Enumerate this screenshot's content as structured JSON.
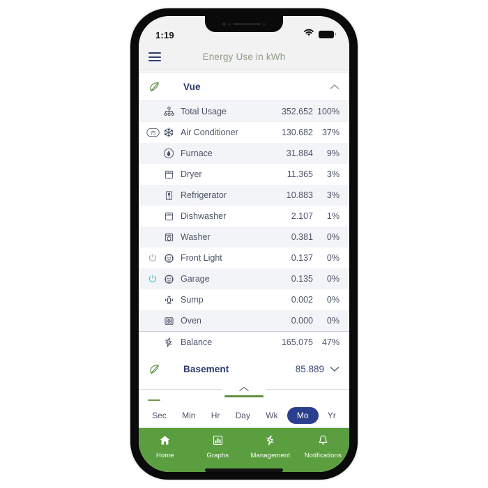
{
  "status_bar": {
    "time": "1:19",
    "wifi_icon": "wifi-icon",
    "battery_icon": "battery-full-icon"
  },
  "app_bar": {
    "menu_icon": "hamburger-menu-icon",
    "title": "Energy Use in kWh",
    "title_color": "#8f9c80"
  },
  "devices": [
    {
      "leaf_icon": "leaf-icon",
      "name": "Vue",
      "value": "",
      "expanded": true,
      "collapse_icon": "chevron-up-icon"
    },
    {
      "leaf_icon": "leaf-icon",
      "name": "Basement",
      "value": "85.889",
      "expanded": false,
      "collapse_icon": "chevron-down-icon"
    }
  ],
  "circuits": [
    {
      "icon": "network-tree-icon",
      "badge": "",
      "label": "Total Usage",
      "value": "352.652",
      "percent": "100%",
      "alt": true,
      "power": ""
    },
    {
      "icon": "snowflake-icon",
      "badge": "75",
      "label": "Air Conditioner",
      "value": "130.682",
      "percent": "37%",
      "alt": false,
      "power": ""
    },
    {
      "icon": "flame-icon",
      "badge": "",
      "label": "Furnace",
      "value": "31.884",
      "percent": "9%",
      "alt": true,
      "power": ""
    },
    {
      "icon": "dryer-icon",
      "badge": "",
      "label": "Dryer",
      "value": "11.365",
      "percent": "3%",
      "alt": false,
      "power": ""
    },
    {
      "icon": "refrigerator-icon",
      "badge": "",
      "label": "Refrigerator",
      "value": "10.883",
      "percent": "3%",
      "alt": true,
      "power": ""
    },
    {
      "icon": "dishwasher-icon",
      "badge": "",
      "label": "Dishwasher",
      "value": "2.107",
      "percent": "1%",
      "alt": false,
      "power": ""
    },
    {
      "icon": "washer-icon",
      "badge": "",
      "label": "Washer",
      "value": "0.381",
      "percent": "0%",
      "alt": true,
      "power": ""
    },
    {
      "icon": "outlet-icon",
      "badge": "",
      "label": "Front Light",
      "value": "0.137",
      "percent": "0%",
      "alt": false,
      "power": "off"
    },
    {
      "icon": "outlet-icon",
      "badge": "",
      "label": "Garage",
      "value": "0.135",
      "percent": "0%",
      "alt": true,
      "power": "on"
    },
    {
      "icon": "sump-pump-icon",
      "badge": "",
      "label": "Sump",
      "value": "0.002",
      "percent": "0%",
      "alt": false,
      "power": ""
    },
    {
      "icon": "oven-icon",
      "badge": "",
      "label": "Oven",
      "value": "0.000",
      "percent": "0%",
      "alt": true,
      "power": ""
    },
    {
      "icon": "lightning-bolt-icon",
      "badge": "",
      "label": "Balance",
      "value": "165.075",
      "percent": "47%",
      "alt": false,
      "power": "",
      "divider_above": true
    }
  ],
  "time_scale": {
    "collapse_icon": "chevron-up-icon",
    "options": [
      "Sec",
      "Min",
      "Hr",
      "Day",
      "Wk",
      "Mo",
      "Yr"
    ],
    "selected": "Mo",
    "selected_color": "#2b3f8f",
    "accent_color": "#5f8f3e"
  },
  "tab_bar": {
    "background_color": "#5b9e3f",
    "tabs": [
      {
        "icon": "home-icon",
        "label": "Home",
        "active": true
      },
      {
        "icon": "bar-chart-icon",
        "label": "Graphs",
        "active": false
      },
      {
        "icon": "lightning-bolt-icon",
        "label": "Management",
        "active": false
      },
      {
        "icon": "bell-icon",
        "label": "Notifications",
        "active": false
      }
    ]
  }
}
